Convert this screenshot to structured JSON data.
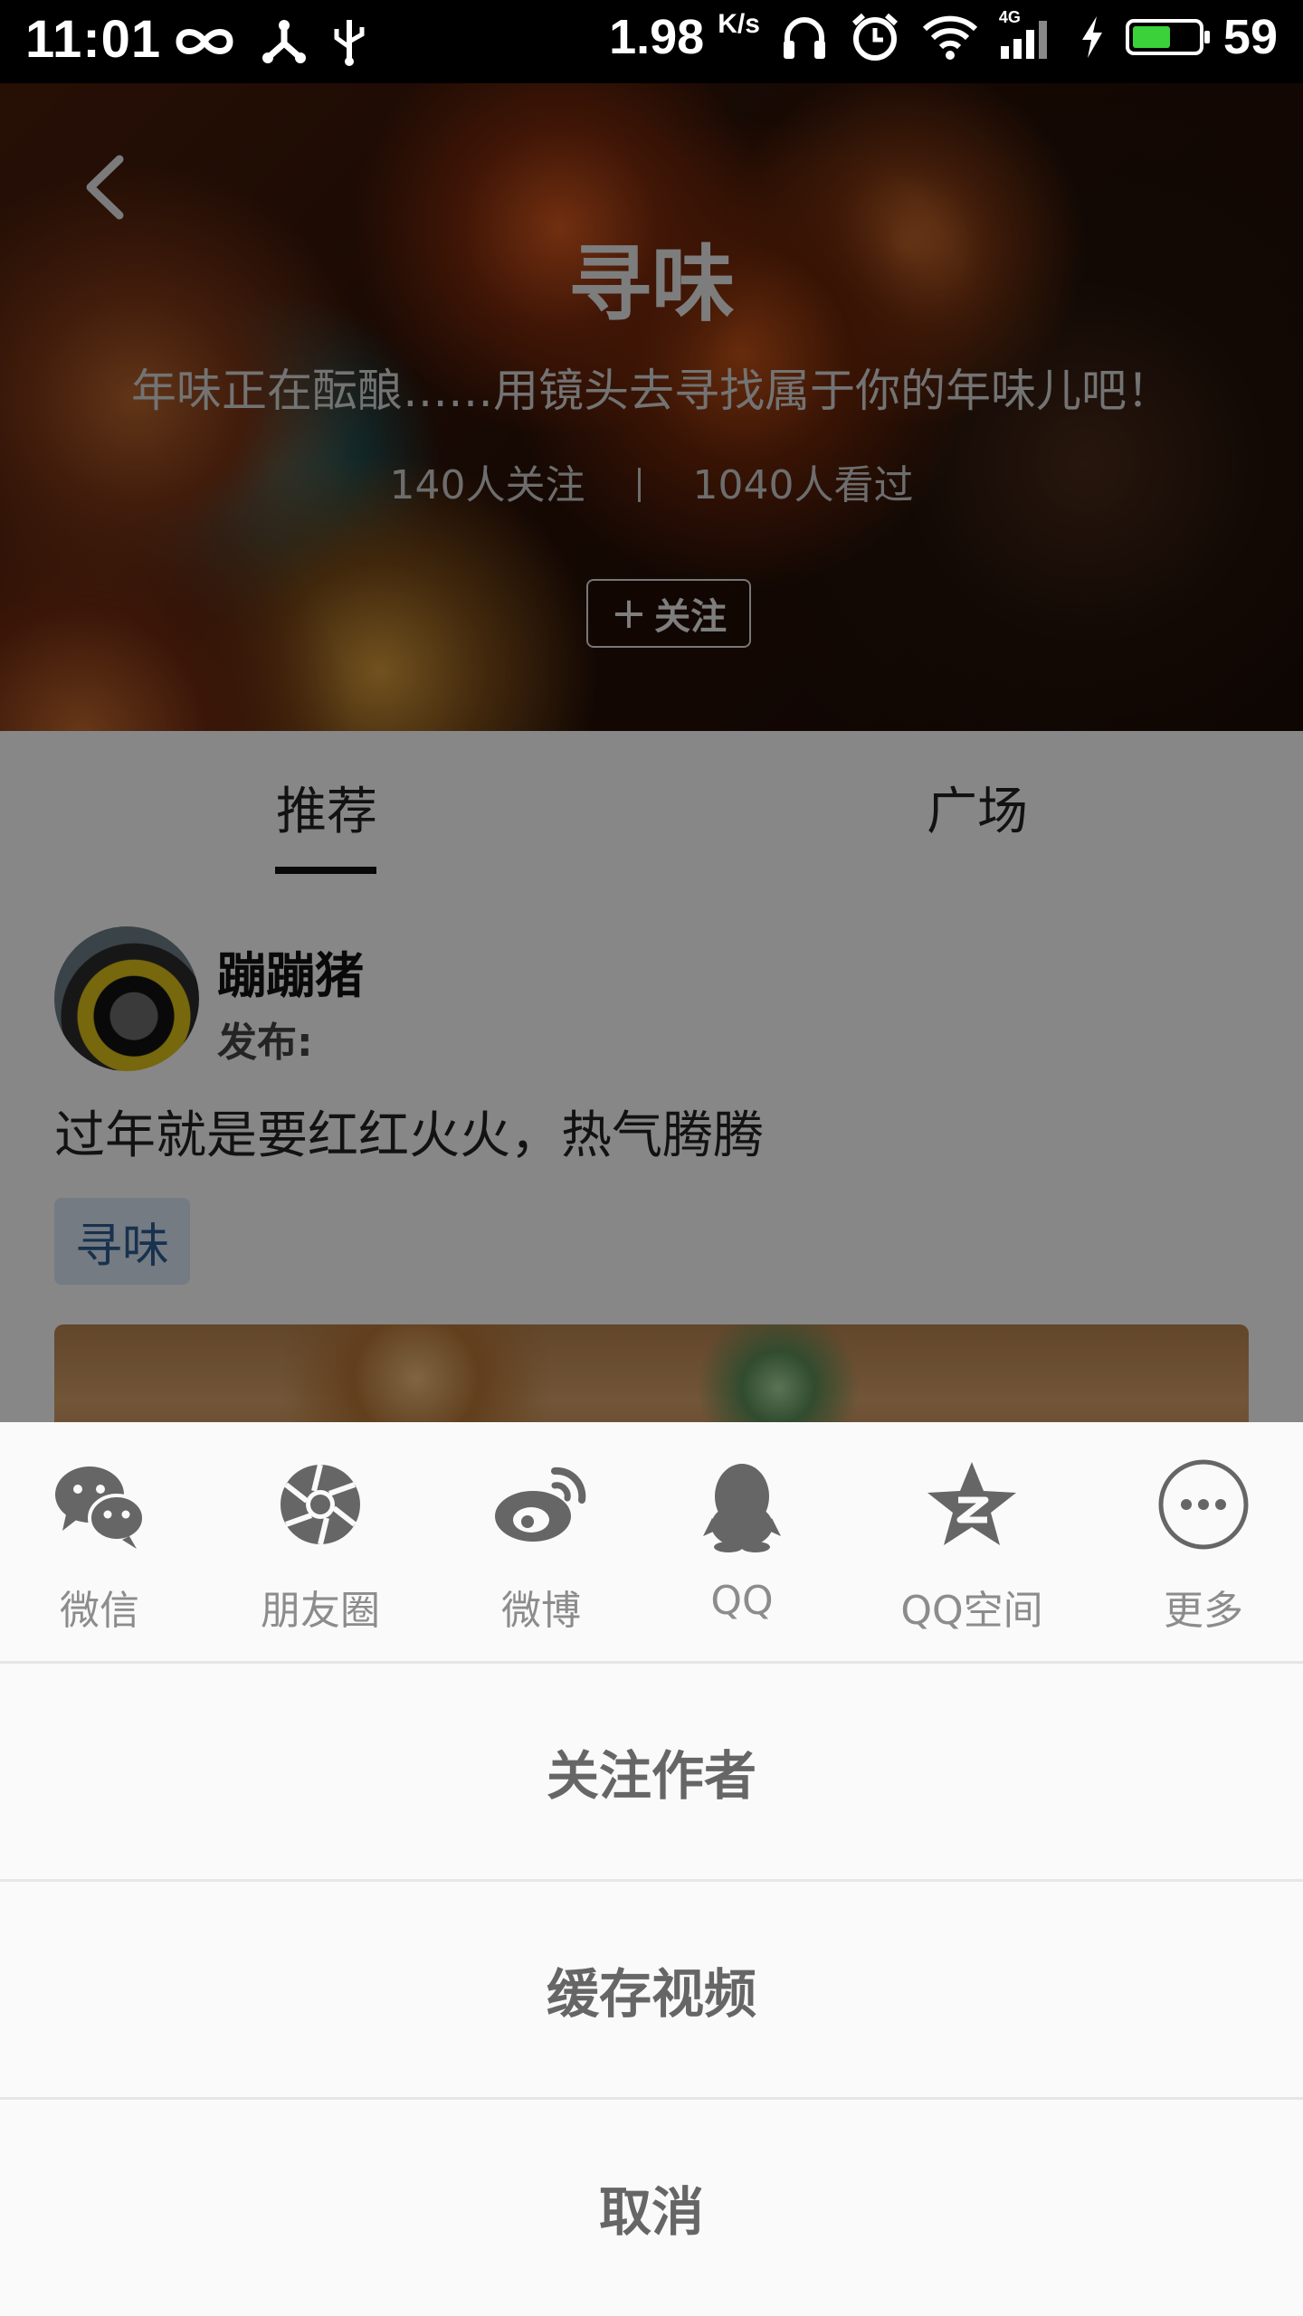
{
  "status_bar": {
    "time": "11:01",
    "speed_value": "1.98",
    "speed_unit": "K/s",
    "network_type": "4G",
    "battery_level": 59,
    "battery_text": "59",
    "icons": [
      "infinity-icon",
      "usb-share-icon",
      "usb-icon",
      "headset-icon",
      "alarm-icon",
      "wifi-icon",
      "signal-icon",
      "charging-icon",
      "battery-icon"
    ]
  },
  "hero": {
    "title": "寻味",
    "subtitle": "年味正在酝酿……用镜头去寻找属于你的年味儿吧！",
    "followers": "140人关注",
    "views": "1040人看过",
    "follow_button": "关注",
    "follow_plus": "+"
  },
  "tabs": [
    {
      "label": "推荐",
      "active": true
    },
    {
      "label": "广场",
      "active": false
    }
  ],
  "post": {
    "author": "蹦蹦猪",
    "publish_label": "发布:",
    "text": "过年就是要红红火火，热气腾腾",
    "tag": "寻味"
  },
  "share_sheet": {
    "targets": [
      {
        "label": "微信",
        "icon": "wechat-icon"
      },
      {
        "label": "朋友圈",
        "icon": "moments-icon"
      },
      {
        "label": "微博",
        "icon": "weibo-icon"
      },
      {
        "label": "QQ",
        "icon": "qq-icon"
      },
      {
        "label": "QQ空间",
        "icon": "qzone-icon"
      },
      {
        "label": "更多",
        "icon": "more-icon"
      }
    ],
    "actions": {
      "follow_author": "关注作者",
      "cache_video": "缓存视频",
      "cancel": "取消"
    }
  },
  "colors": {
    "status_bar_bg": "#000000",
    "battery_fill": "#3ad13a",
    "tag_bg": "#dce9f8",
    "tag_text": "#2f5d92",
    "sheet_bg": "#fafafa",
    "share_icon": "#666666",
    "overlay": "rgba(0,0,0,0.47)"
  }
}
